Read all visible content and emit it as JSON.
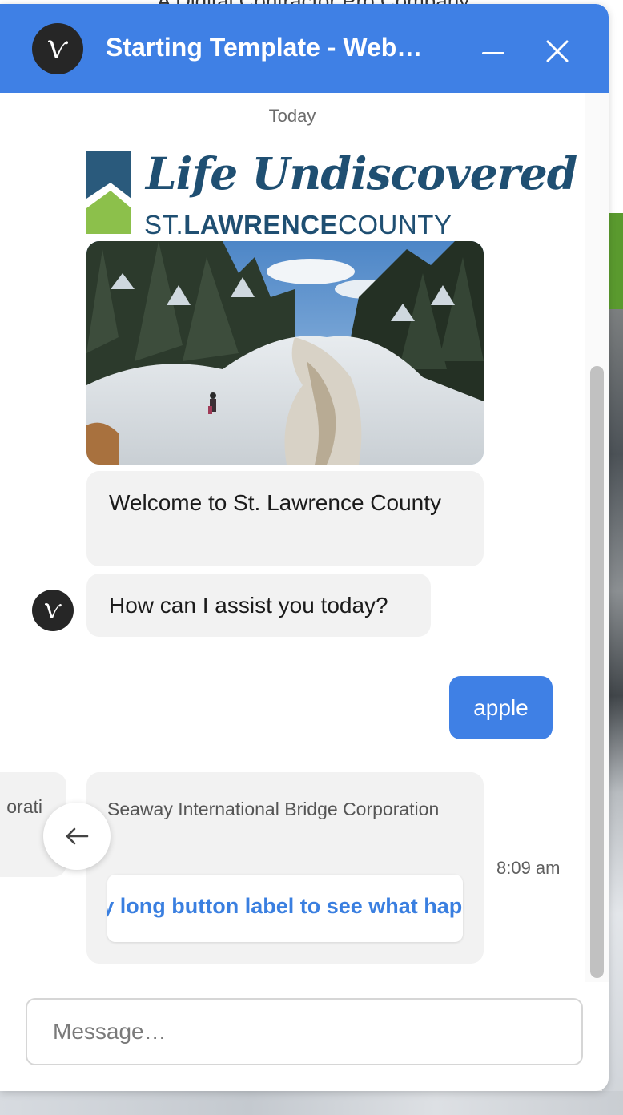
{
  "background_page": {
    "top_text": "A Digital Contractor Pro Company"
  },
  "header": {
    "title": "Starting Template - Web…",
    "avatar_icon": "v-logo-icon",
    "minimize_icon": "minimize-icon",
    "close_icon": "close-icon",
    "background_color": "#3f80e5"
  },
  "conversation": {
    "date_separator": "Today",
    "logo": {
      "script_text": "Life Undiscovered",
      "county_prefix": "ST.",
      "county_bold": "LAWRENCE",
      "county_suffix": "COUNTY"
    },
    "photo_icon": "winter-waterfall-image",
    "bot_messages": [
      "Welcome to St. Lawrence County",
      "How can I assist you today?"
    ],
    "user_message": "apple",
    "carousel": {
      "previous_card_text": "orati",
      "card_text": "Seaway International Bridge Corporation",
      "card_button_label": "really long button label to see what happens",
      "prev_arrow_icon": "arrow-left-icon"
    },
    "timestamp": "8:09 am"
  },
  "composer": {
    "placeholder": "Message…",
    "value": ""
  },
  "colors": {
    "accent": "#3f80e5",
    "bubble_bg": "#f2f2f2",
    "logo_navy": "#1f4f72",
    "logo_green": "#8cc04b"
  }
}
